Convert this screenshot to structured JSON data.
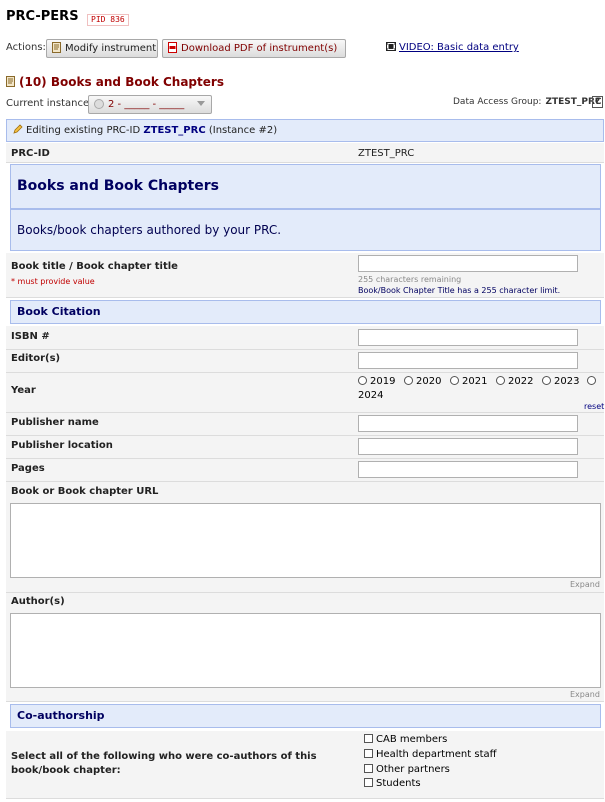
{
  "project": {
    "title": "PRC-PERS",
    "pid": "PID 836"
  },
  "actions": {
    "label": "Actions:",
    "modify_label": "Modify instrument",
    "pdf_label": "Download PDF of instrument(s)",
    "video_label": "VIDEO: Basic data entry"
  },
  "instrument": {
    "title": "(10) Books and Book Chapters",
    "current_instance_label": "Current instance:",
    "instance_value": "2 - _____ - _____",
    "dag_label": "Data Access Group:",
    "dag_value": "ZTEST_PRC",
    "dag_help": "?"
  },
  "editing": {
    "prefix": "Editing existing PRC-ID",
    "record_id": "ZTEST_PRC",
    "suffix": "(Instance #2)"
  },
  "form": {
    "prc_id_label": "PRC-ID",
    "prc_id_value": "ZTEST_PRC",
    "header_title": "Books and Book Chapters",
    "header_desc": "Books/book chapters authored by your PRC.",
    "book_title_label": "Book title / Book chapter title",
    "must_provide": "* must provide value",
    "chars_remaining": "255 characters remaining",
    "char_limit_note": "Book/Book Chapter Title has a 255 character limit.",
    "citation_header": "Book Citation",
    "isbn_label": "ISBN #",
    "editors_label": "Editor(s)",
    "year_label": "Year",
    "year_options": [
      "2019",
      "2020",
      "2021",
      "2022",
      "2023",
      "2024"
    ],
    "reset_label": "reset",
    "publisher_name_label": "Publisher name",
    "publisher_location_label": "Publisher location",
    "pages_label": "Pages",
    "url_label": "Book or Book chapter URL",
    "expand_label": "Expand",
    "authors_label": "Author(s)",
    "coauth_header": "Co-authorship",
    "coauth_question": "Select all of the following who were co-authors of this book/book chapter:",
    "coauth_options": [
      "CAB members",
      "Health department staff",
      "Other partners",
      "Students"
    ]
  },
  "colors": {
    "accent_blue": "#000060",
    "header_bg": "#e3ebfa",
    "instrument_title": "#800000",
    "required": "#c00000"
  }
}
